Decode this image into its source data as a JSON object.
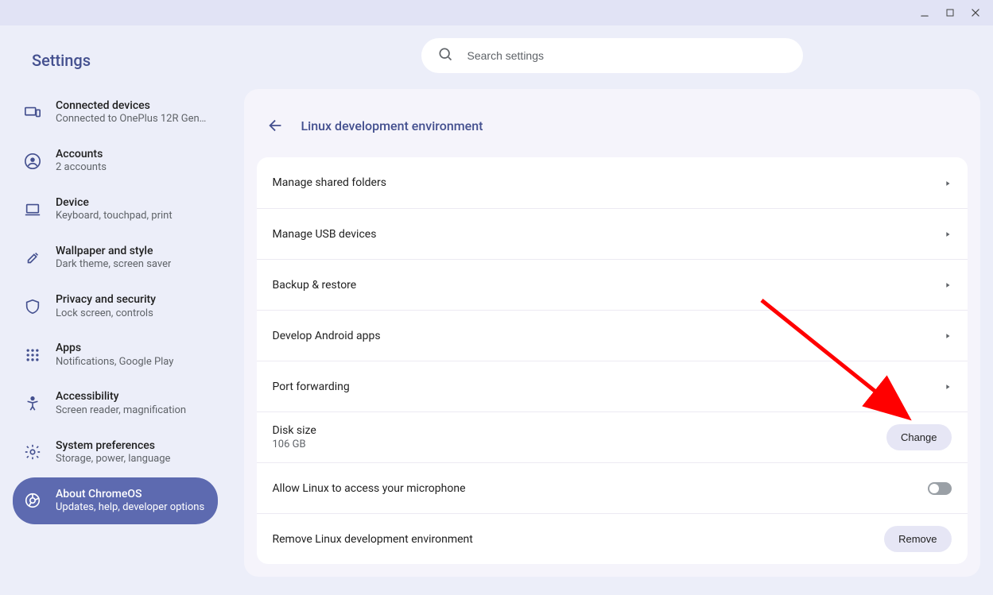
{
  "app_title": "Settings",
  "search": {
    "placeholder": "Search settings"
  },
  "sidebar": {
    "items": [
      {
        "label": "Connected devices",
        "sub": "Connected to OnePlus 12R Gens…",
        "icon": "devices"
      },
      {
        "label": "Accounts",
        "sub": "2 accounts",
        "icon": "account"
      },
      {
        "label": "Device",
        "sub": "Keyboard, touchpad, print",
        "icon": "laptop"
      },
      {
        "label": "Wallpaper and style",
        "sub": "Dark theme, screen saver",
        "icon": "brush"
      },
      {
        "label": "Privacy and security",
        "sub": "Lock screen, controls",
        "icon": "shield"
      },
      {
        "label": "Apps",
        "sub": "Notifications, Google Play",
        "icon": "grid"
      },
      {
        "label": "Accessibility",
        "sub": "Screen reader, magnification",
        "icon": "accessibility"
      },
      {
        "label": "System preferences",
        "sub": "Storage, power, language",
        "icon": "gear"
      },
      {
        "label": "About ChromeOS",
        "sub": "Updates, help, developer options",
        "icon": "chrome",
        "active": true
      }
    ]
  },
  "panel": {
    "title": "Linux development environment",
    "rows": [
      {
        "label": "Manage shared folders",
        "action": "nav"
      },
      {
        "label": "Manage USB devices",
        "action": "nav"
      },
      {
        "label": "Backup & restore",
        "action": "nav"
      },
      {
        "label": "Develop Android apps",
        "action": "nav"
      },
      {
        "label": "Port forwarding",
        "action": "nav"
      },
      {
        "label": "Disk size",
        "sub": "106 GB",
        "action": "button",
        "button": "Change"
      },
      {
        "label": "Allow Linux to access your microphone",
        "action": "toggle",
        "toggle": false
      },
      {
        "label": "Remove Linux development environment",
        "action": "button",
        "button": "Remove"
      }
    ]
  }
}
